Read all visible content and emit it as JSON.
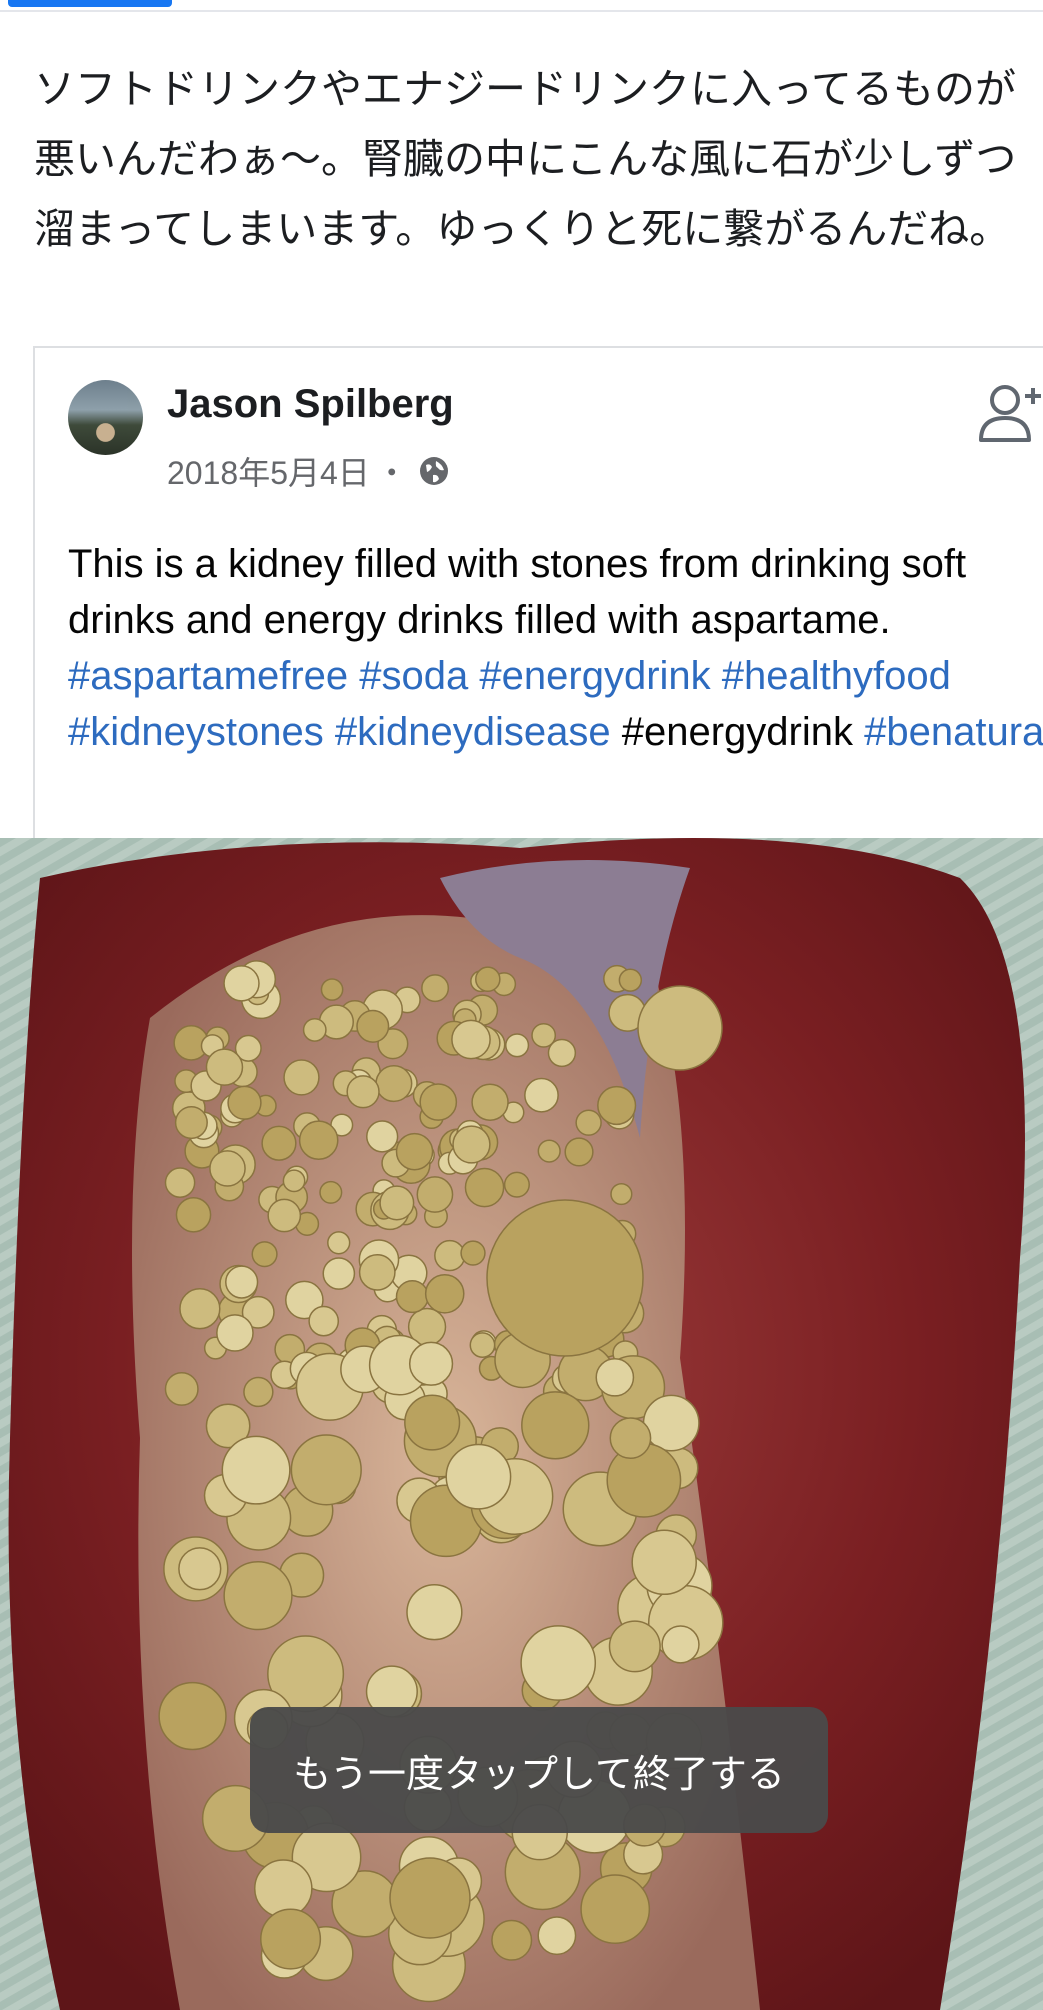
{
  "post": {
    "text": "ソフトドリンクやエナジードリンクに入ってるものが悪いんだわぁ〜。腎臓の中にこんな風に石が少しずつ溜まってしまいます。ゆっくりと死に繋がるんだね。"
  },
  "shared": {
    "author": "Jason Spilberg",
    "date": "2018年5月4日",
    "separator": "・",
    "body_text": "This is a kidney filled with stones from drinking soft drinks and energy drinks filled with aspartame.",
    "hashtags": [
      {
        "text": "#aspartamefree",
        "linked": true
      },
      {
        "text": "#soda",
        "linked": true
      },
      {
        "text": "#energydrink",
        "linked": true
      },
      {
        "text": "#healthyfood",
        "linked": true
      },
      {
        "text": "#kidneystones",
        "linked": true
      },
      {
        "text": "#kidneydisease",
        "linked": true
      },
      {
        "text": "#energydrink",
        "linked": false
      },
      {
        "text": "#benatural",
        "linked": true
      }
    ]
  },
  "toast": {
    "message": "もう一度タップして終了する"
  },
  "icons": {
    "privacy": "globe-icon",
    "add_friend": "add-friend-icon"
  },
  "colors": {
    "link": "#2d6bbf",
    "toast_bg": "#4a4a4a",
    "accent": "#1877f2"
  }
}
